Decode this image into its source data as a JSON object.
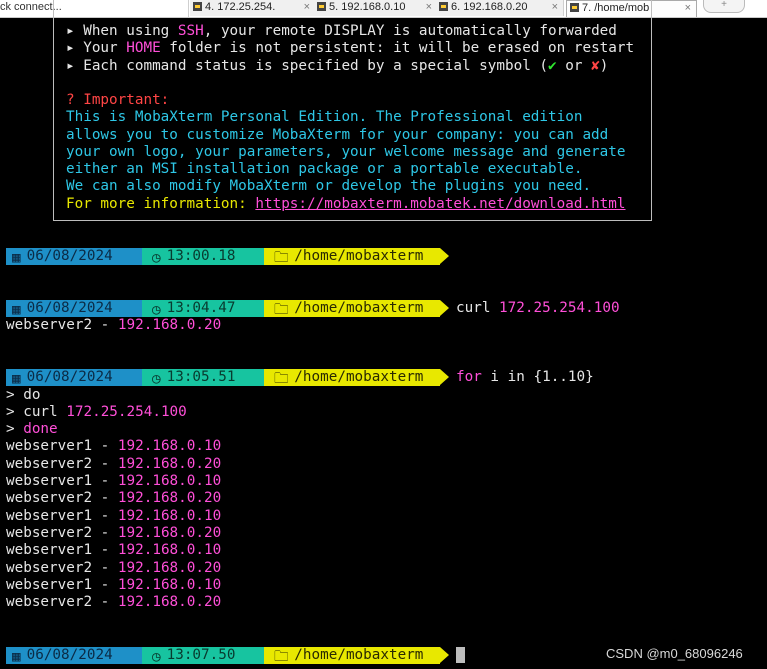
{
  "tabbar": {
    "quick_connect": "ck connect...",
    "tabs": [
      {
        "label": "4. 172.25.254.",
        "close": "×"
      },
      {
        "label": "5. 192.168.0.10",
        "close": "×"
      },
      {
        "label": "6. 192.168.0.20",
        "close": "×"
      },
      {
        "label": "7. /home/mob",
        "close": "×"
      }
    ],
    "new_tab": "+"
  },
  "welcome": {
    "bullets": [
      {
        "pre": "When using ",
        "hl": "SSH",
        "post": ", your remote DISPLAY is automatically forwarded"
      },
      {
        "pre": "Your ",
        "hl": "HOME",
        "post": " folder is not persistent: it will be erased on restart"
      },
      {
        "text": "Each command status is specified by a special symbol (",
        "ok": "✔",
        "or": " or ",
        "ko": "✘",
        "close": ")"
      }
    ],
    "bullet_char": "▸",
    "important": "? Important:",
    "edition_lines": [
      "This is MobaXterm Personal Edition. The Professional edition",
      "allows you to customize MobaXterm for your company: you can add",
      "your own logo, your parameters, your welcome message and generate",
      "either an MSI installation package or a portable executable.",
      "We can also modify MobaXterm or develop the plugins you need."
    ],
    "more_info": "For more information: ",
    "link": "https://mobaxterm.mobatek.net/download.html"
  },
  "prompts": [
    {
      "date": "06/08/2024",
      "time": "13:00.18",
      "path": "/home/mobaxterm"
    },
    {
      "date": "06/08/2024",
      "time": "13:04.47",
      "path": "/home/mobaxterm",
      "cmd": "curl",
      "arg": "172.25.254.100"
    },
    {
      "date": "06/08/2024",
      "time": "13:05.51",
      "path": "/home/mobaxterm",
      "cmd_for": "for",
      "cmd_rest": " i in {1..10}"
    },
    {
      "date": "06/08/2024",
      "time": "13:07.50",
      "path": "/home/mobaxterm"
    }
  ],
  "output1": {
    "host": "webserver2",
    "sep": " - ",
    "ip": "192.168.0.20"
  },
  "loop": {
    "l1_pre": "> ",
    "l1": "do",
    "l2_pre": "> curl ",
    "l2_ip": "172.25.254.100",
    "l3_pre": "> ",
    "l3": "done"
  },
  "results": [
    {
      "host": "webserver1",
      "ip": "192.168.0.10"
    },
    {
      "host": "webserver2",
      "ip": "192.168.0.20"
    },
    {
      "host": "webserver1",
      "ip": "192.168.0.10"
    },
    {
      "host": "webserver2",
      "ip": "192.168.0.20"
    },
    {
      "host": "webserver1",
      "ip": "192.168.0.10"
    },
    {
      "host": "webserver2",
      "ip": "192.168.0.20"
    },
    {
      "host": "webserver1",
      "ip": "192.168.0.10"
    },
    {
      "host": "webserver2",
      "ip": "192.168.0.20"
    },
    {
      "host": "webserver1",
      "ip": "192.168.0.10"
    },
    {
      "host": "webserver2",
      "ip": "192.168.0.20"
    }
  ],
  "sep": " - ",
  "watermark": "CSDN @m0_68096246",
  "colors": {
    "date_seg": "#1e90c8",
    "time_seg": "#17c4a0",
    "path_seg": "#e8e800",
    "ip": "#ff4fd8",
    "important": "#ff4545"
  }
}
